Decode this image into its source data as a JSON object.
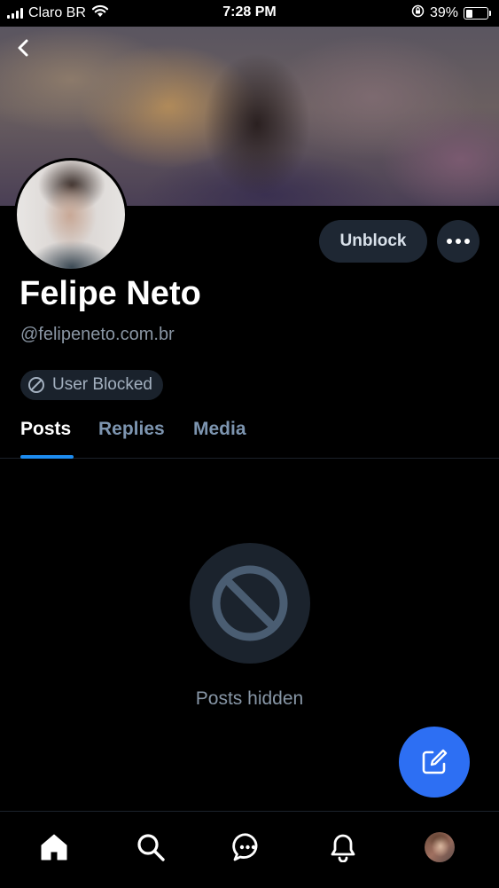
{
  "status_bar": {
    "carrier": "Claro BR",
    "time": "7:28 PM",
    "battery_percent": "39%",
    "battery_level": 0.39,
    "icons": [
      "signal-icon",
      "wifi-icon",
      "rotation-lock-icon",
      "battery-icon"
    ]
  },
  "profile": {
    "display_name": "Felipe Neto",
    "handle": "@felipeneto.com.br",
    "blocked_badge": "User Blocked"
  },
  "actions": {
    "unblock_label": "Unblock",
    "more_icon": "ellipsis-icon"
  },
  "tabs": [
    {
      "label": "Posts",
      "active": true
    },
    {
      "label": "Replies",
      "active": false
    },
    {
      "label": "Media",
      "active": false
    }
  ],
  "empty_state": {
    "icon": "block-icon",
    "text": "Posts hidden"
  },
  "fab": {
    "icon": "compose-icon"
  },
  "bottom_nav": [
    "home-icon",
    "search-icon",
    "chat-icon",
    "notifications-icon",
    "profile-avatar"
  ],
  "colors": {
    "accent": "#1d8cf0",
    "fab": "#2d6ff3",
    "button_bg": "#1e2733",
    "muted_text": "#8a96a4"
  }
}
